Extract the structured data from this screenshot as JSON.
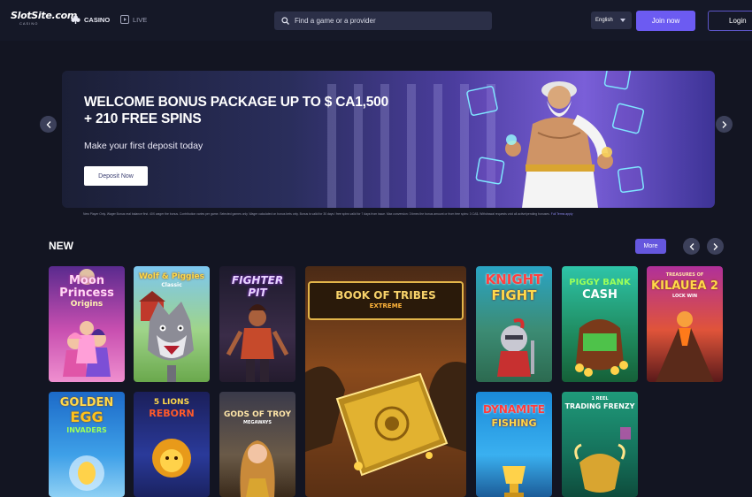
{
  "header": {
    "logo_text": "SlotSite.com",
    "logo_sub": "CASINO",
    "nav": [
      {
        "label": "CASINO",
        "icon": "clubs-icon"
      },
      {
        "label": "LIVE",
        "icon": "live-play-icon"
      }
    ],
    "search_placeholder": "Find a game or a provider",
    "language": "English",
    "join_label": "Join now",
    "login_label": "Login"
  },
  "hero": {
    "title_line1": "WELCOME BONUS PACKAGE UP TO $ CA1,500",
    "title_line2": "+ 210 FREE SPINS",
    "subtitle": "Make your first deposit today",
    "cta": "Deposit Now",
    "disclaimer": "New Player Only. Wager Bonus real balance first. 40X wager the bonus. Contribution varies per game. Selected games only. Wager calculated on bonus bets only. Bonus is valid for 30 days / free spins valid for 7 days from issue. Max conversion: 3 times the bonus amount or from free spins: 3 CA$. Withdrawal requests void all active/pending bonuses.",
    "disclaimer_link": "Full Terms apply"
  },
  "section": {
    "title": "NEW",
    "more_label": "More"
  },
  "games": [
    {
      "line1": "Moon",
      "line2": "Princess",
      "line3": "Origins"
    },
    {
      "line1": "Wolf & Piggies",
      "line2": "Classic",
      "line3": ""
    },
    {
      "line1": "FIGHTER",
      "line2": "PIT",
      "line3": ""
    },
    {
      "line1": "BOOK OF TRIBES",
      "line2": "EXTREME",
      "line3": ""
    },
    {
      "line1": "KNIGHT",
      "line2": "FIGHT",
      "line3": ""
    },
    {
      "line1": "PIGGY BANK",
      "line2": "CASH",
      "line3": ""
    },
    {
      "line1": "TREASURES OF",
      "line2": "KILAUEA 2",
      "line3": "LOCK WIN"
    },
    {
      "line1": "GOLDEN",
      "line2": "EGG",
      "line3": "INVADERS"
    },
    {
      "line1": "5 LIONS",
      "line2": "REBORN",
      "line3": ""
    },
    {
      "line1": "GODS OF TROY",
      "line2": "MEGAWAYS",
      "line3": ""
    },
    {
      "line1": "DYNAMITE",
      "line2": "FISHING",
      "line3": ""
    },
    {
      "line1": "1 REEL",
      "line2": "TRADING FRENZY",
      "line3": ""
    }
  ]
}
